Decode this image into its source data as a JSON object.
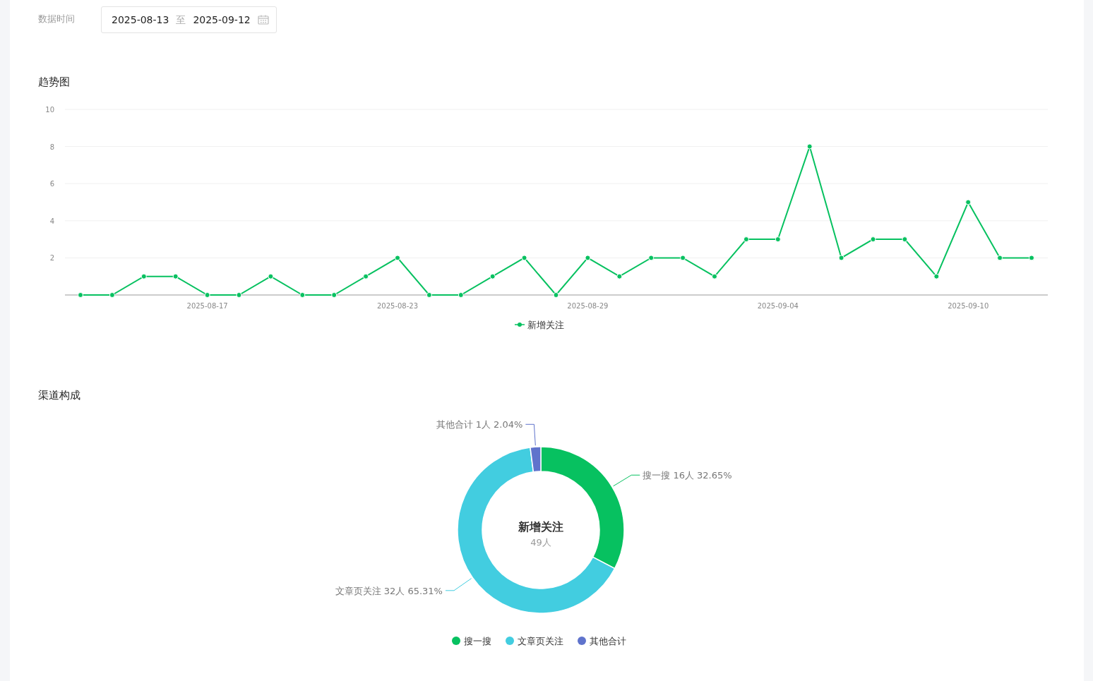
{
  "filter": {
    "label": "数据时间",
    "start_date": "2025-08-13",
    "separator": "至",
    "end_date": "2025-09-12"
  },
  "trend": {
    "title": "趋势图",
    "chart_data": {
      "type": "line",
      "categories": [
        null,
        null,
        null,
        null,
        "2025-08-17",
        null,
        null,
        null,
        null,
        null,
        "2025-08-23",
        null,
        null,
        null,
        null,
        null,
        "2025-08-29",
        null,
        null,
        null,
        null,
        null,
        "2025-09-04",
        null,
        null,
        null,
        null,
        null,
        "2025-09-10",
        null,
        null
      ],
      "grid": true,
      "ylim": [
        0,
        10
      ],
      "yticks": [
        2,
        4,
        6,
        8,
        10
      ],
      "series": [
        {
          "name": "新增关注",
          "color": "#07c160",
          "marker": true,
          "values": [
            0,
            0,
            1,
            1,
            0,
            0,
            1,
            0,
            0,
            1,
            2,
            0,
            0,
            1,
            2,
            0,
            2,
            1,
            2,
            2,
            1,
            3,
            3,
            8,
            2,
            3,
            3,
            1,
            5,
            2,
            2
          ]
        }
      ]
    }
  },
  "channels": {
    "title": "渠道构成",
    "center_value": "49人",
    "chart_data": {
      "type": "donut",
      "categories": [
        "搜一搜",
        "文章页关注",
        "其他合计"
      ],
      "series": [
        {
          "name": "新增关注",
          "values": [
            32.65,
            65.31,
            2.04
          ]
        }
      ],
      "value_labels": [
        "搜一搜 16人 32.65%",
        "文章页关注 32人 65.31%",
        "其他合计 1人 2.04%"
      ]
    },
    "legend": [
      {
        "color": "#07c160"
      },
      {
        "color": "#42cde0"
      },
      {
        "color": "#5f73cc"
      }
    ]
  }
}
